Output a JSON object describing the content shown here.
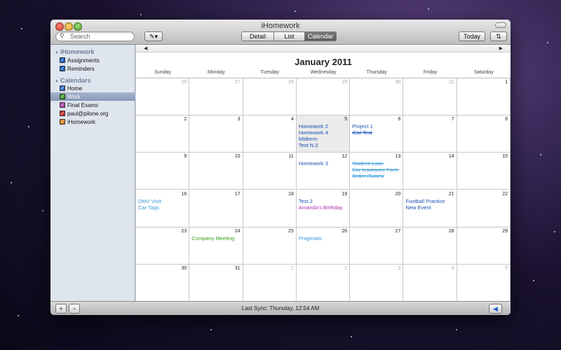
{
  "window": {
    "title": "iHomework"
  },
  "toolbar": {
    "search_placeholder": "Search",
    "edit_icon": "pencil-icon",
    "views": [
      "Detail",
      "List",
      "Calendar"
    ],
    "active_view": "Calendar",
    "today_label": "Today",
    "sync_icon": "sync-arrows-icon"
  },
  "sidebar": {
    "sections": [
      {
        "title": "iHomework",
        "items": [
          {
            "label": "Assignments",
            "checked": true,
            "color": "#1a5fc7"
          },
          {
            "label": "Reminders",
            "checked": true,
            "color": "#1a5fc7"
          }
        ]
      },
      {
        "title": "Calendars",
        "items": [
          {
            "label": "Home",
            "checked": true,
            "color": "#2a6fd0"
          },
          {
            "label": "Work",
            "checked": true,
            "color": "#3aa020",
            "selected": true
          },
          {
            "label": "Final Exams",
            "checked": true,
            "color": "#b040b0"
          },
          {
            "label": "paul@pilone.org",
            "checked": true,
            "color": "#c03030"
          },
          {
            "label": "iHomework",
            "checked": true,
            "color": "#e08020"
          }
        ]
      }
    ]
  },
  "calendar": {
    "month_title": "January 2011",
    "days_of_week": [
      "Sunday",
      "Monday",
      "Tuesday",
      "Wednesday",
      "Thursday",
      "Friday",
      "Saturday"
    ],
    "today": 5,
    "weeks": [
      [
        {
          "d": "26",
          "o": true
        },
        {
          "d": "27",
          "o": true
        },
        {
          "d": "28",
          "o": true
        },
        {
          "d": "29",
          "o": true
        },
        {
          "d": "30",
          "o": true
        },
        {
          "d": "31",
          "o": true
        },
        {
          "d": "1"
        }
      ],
      [
        {
          "d": "2"
        },
        {
          "d": "3"
        },
        {
          "d": "4"
        },
        {
          "d": "5",
          "ev": [
            {
              "t": "Homework 2",
              "c": "#1a4fb5"
            },
            {
              "t": "Homework 4",
              "c": "#1a4fb5"
            },
            {
              "t": "Midterm",
              "c": "#1a4fb5"
            },
            {
              "t": "Test N.3",
              "c": "#1a4fb5"
            }
          ]
        },
        {
          "d": "6",
          "ev": [
            {
              "t": "Project 1",
              "c": "#1a4fb5"
            },
            {
              "t": "iCal Test",
              "c": "#1a4fb5",
              "x": true
            }
          ]
        },
        {
          "d": "7"
        },
        {
          "d": "8"
        }
      ],
      [
        {
          "d": "9"
        },
        {
          "d": "10"
        },
        {
          "d": "11"
        },
        {
          "d": "12",
          "ev": [
            {
              "t": "Homework 3",
              "c": "#1a4fb5"
            }
          ]
        },
        {
          "d": "13",
          "ev": [
            {
              "t": "Student Loan",
              "c": "#3a9ad8",
              "x": true
            },
            {
              "t": "Car Insurance Form",
              "c": "#3a9ad8",
              "x": true
            },
            {
              "t": "Order iTunes/",
              "c": "#3a9ad8",
              "x": true
            }
          ]
        },
        {
          "d": "14"
        },
        {
          "d": "15"
        }
      ],
      [
        {
          "d": "16",
          "ev": [
            {
              "t": "DMV Visit",
              "c": "#3a9ad8"
            },
            {
              "t": "Car Tags",
              "c": "#3a9ad8"
            }
          ]
        },
        {
          "d": "17"
        },
        {
          "d": "18"
        },
        {
          "d": "19",
          "ev": [
            {
              "t": "Test 2",
              "c": "#1a4fb5"
            },
            {
              "t": "Amanda's Birthday",
              "c": "#b030b0"
            }
          ]
        },
        {
          "d": "20"
        },
        {
          "d": "21",
          "ev": [
            {
              "t": "Football Practice",
              "c": "#1a4fb5"
            },
            {
              "t": "New Event",
              "c": "#1a4fb5"
            }
          ]
        },
        {
          "d": "22"
        }
      ],
      [
        {
          "d": "23"
        },
        {
          "d": "24",
          "ev": [
            {
              "t": "Company Meeting",
              "c": "#3aa020"
            }
          ]
        },
        {
          "d": "25"
        },
        {
          "d": "26",
          "ev": [
            {
              "t": "Pragmatic",
              "c": "#3a9ad8"
            }
          ]
        },
        {
          "d": "27"
        },
        {
          "d": "28"
        },
        {
          "d": "29"
        }
      ],
      [
        {
          "d": "30"
        },
        {
          "d": "31"
        },
        {
          "d": "1",
          "o": true
        },
        {
          "d": "2",
          "o": true
        },
        {
          "d": "3",
          "o": true
        },
        {
          "d": "4",
          "o": true
        },
        {
          "d": "5",
          "o": true
        }
      ]
    ]
  },
  "bottombar": {
    "add_label": "+",
    "remove_label": "−",
    "sync_status": "Last Sync: Thursday, 12:54 AM",
    "back_icon": "back-arrow-icon"
  }
}
